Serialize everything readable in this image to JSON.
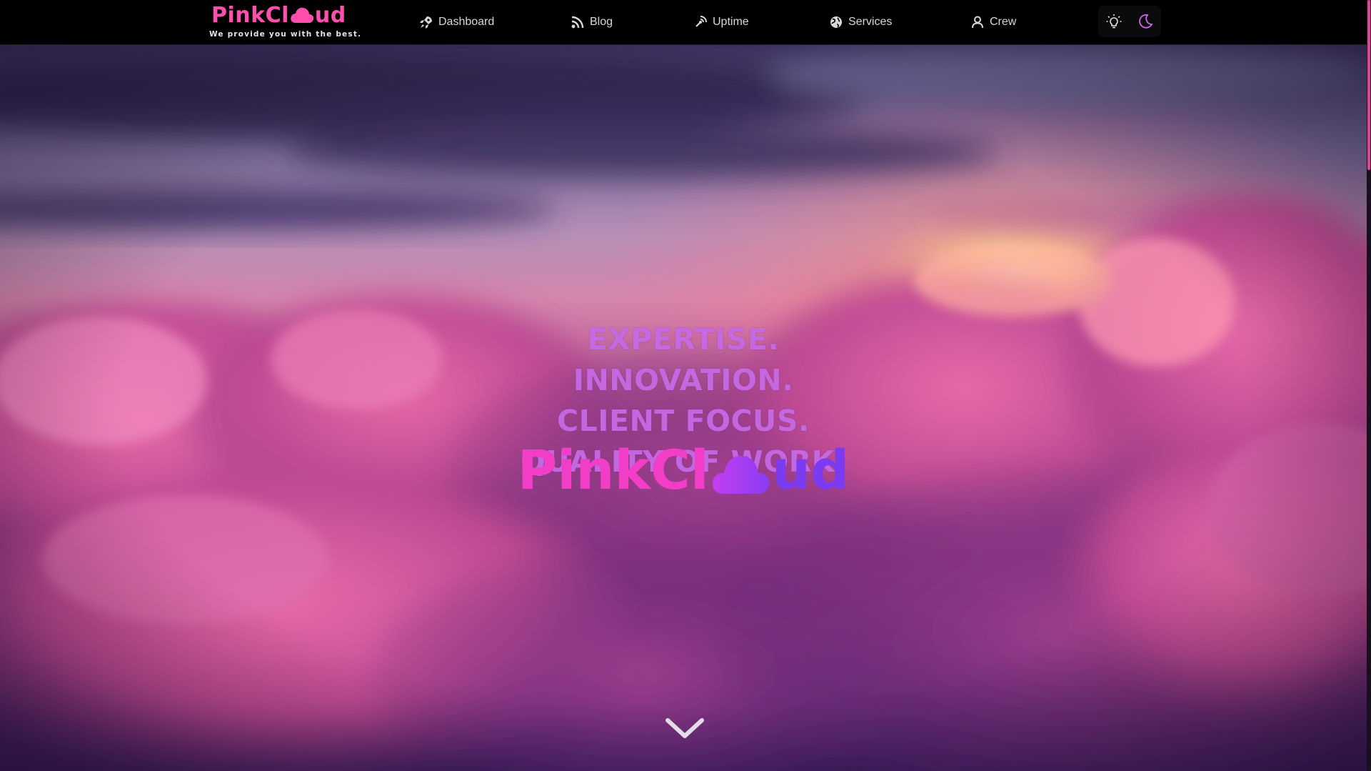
{
  "brand": {
    "name_part1": "PinkCl",
    "name_part2": "ud",
    "tagline": "We provide you with the best."
  },
  "nav": {
    "items": [
      {
        "label": "Dashboard",
        "icon": "rocket-icon"
      },
      {
        "label": "Blog",
        "icon": "rss-icon"
      },
      {
        "label": "Uptime",
        "icon": "signal-icon"
      },
      {
        "label": "Services",
        "icon": "globe-icon"
      },
      {
        "label": "Crew",
        "icon": "user-icon"
      }
    ]
  },
  "theme": {
    "light_icon": "lightbulb-icon",
    "dark_icon": "moon-icon",
    "active": "dark"
  },
  "hero": {
    "slogans": [
      "EXPERTISE.",
      "INNOVATION.",
      "CLIENT FOCUS.",
      "QUALITY OF WORK."
    ],
    "logo_part1": "PinkCl",
    "logo_part2": "ud",
    "scroll_icon": "chevron-down-icon"
  },
  "colors": {
    "brand_pink": "#ff4fae",
    "slogan": "#c56ae4",
    "logo_pink": "#f23dc6",
    "logo_purple": "#7b3bf0",
    "navbar_bg": "#000000",
    "scroll_thumb": "#e2439a"
  }
}
